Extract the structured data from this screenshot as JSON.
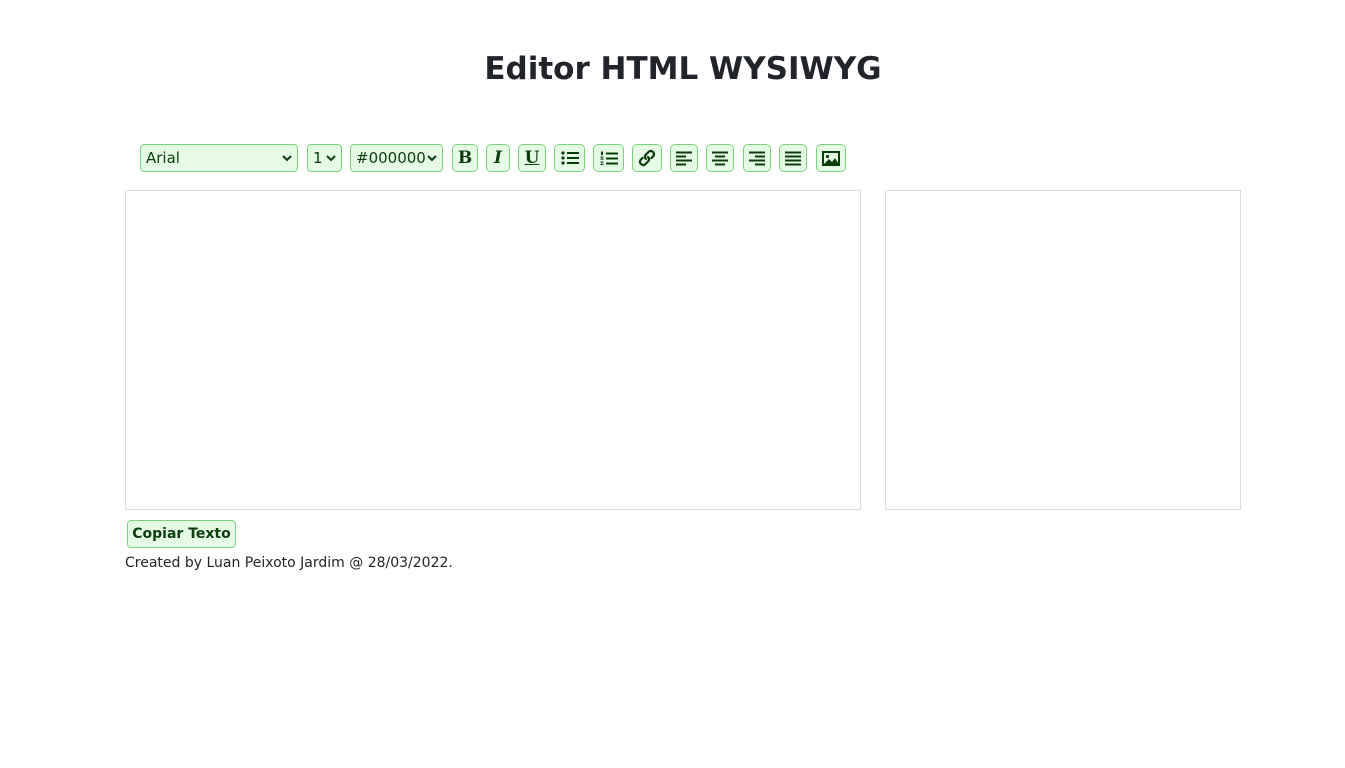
{
  "header": {
    "title": "Editor HTML WYSIWYG"
  },
  "toolbar": {
    "font_family": {
      "value": "Arial",
      "icon": "chevron-down-icon"
    },
    "font_size": {
      "value": "1",
      "icon": "chevron-down-icon"
    },
    "font_color": {
      "value": "#000000",
      "icon": "chevron-down-icon"
    },
    "buttons": [
      {
        "name": "bold",
        "glyph": "B",
        "icon": "bold-icon"
      },
      {
        "name": "italic",
        "glyph": "I",
        "icon": "italic-icon"
      },
      {
        "name": "underline",
        "glyph": "U",
        "icon": "underline-icon"
      },
      {
        "name": "unordered-list",
        "icon": "bullet-list-icon"
      },
      {
        "name": "ordered-list",
        "icon": "numbered-list-icon"
      },
      {
        "name": "link",
        "icon": "link-icon"
      },
      {
        "name": "align-left",
        "icon": "align-left-icon"
      },
      {
        "name": "align-center",
        "icon": "align-center-icon"
      },
      {
        "name": "align-right",
        "icon": "align-right-icon"
      },
      {
        "name": "align-justify",
        "icon": "align-justify-icon"
      },
      {
        "name": "insert-image",
        "icon": "image-icon"
      }
    ]
  },
  "editor": {
    "content": ""
  },
  "preview": {
    "content": ""
  },
  "actions": {
    "copy_label": "Copiar Texto"
  },
  "footer": {
    "credit": "Created by Luan Peixoto Jardim @ 28/03/2022."
  },
  "colors": {
    "button_bg": "#e6fbe6",
    "button_border": "#7cd37c",
    "button_text": "#0b3d0b",
    "text": "#212529",
    "panel_border": "#dcdcdc"
  }
}
